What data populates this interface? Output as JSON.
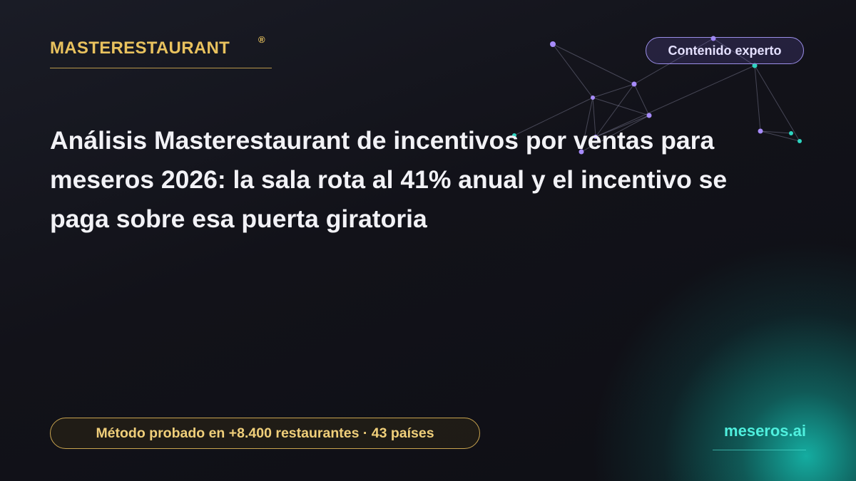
{
  "brand": {
    "name": "MASTERESTAURANT",
    "mark": "®"
  },
  "badge": {
    "label": "Contenido experto"
  },
  "headline": "Análisis Masterestaurant de incentivos por ventas para meseros 2026: la sala rota al 41% anual y el incentivo se paga sobre esa puerta giratoria",
  "footer": {
    "method": "Método probado en +8.400 restaurantes · 43 países",
    "site": "meseros.ai"
  },
  "colors": {
    "gold": "#e9c25e",
    "teal": "#4ff0de",
    "lavender": "#9b8ee8",
    "background": "#101018"
  },
  "decor": {
    "icon": "network-graph-icon"
  }
}
